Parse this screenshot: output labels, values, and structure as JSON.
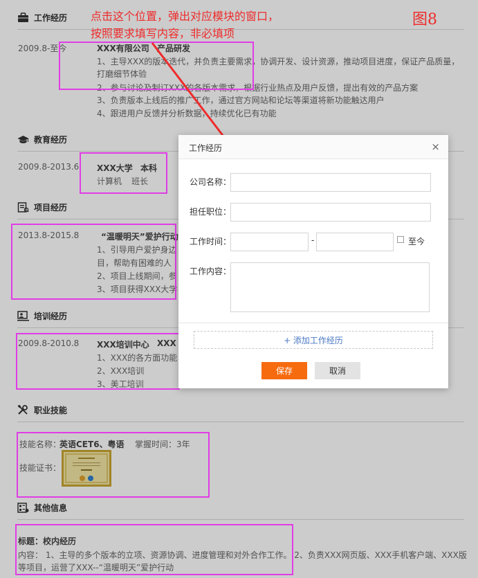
{
  "annotation": {
    "line1": "点击这个位置，弹出对应模块的窗口，",
    "line2": "按照要求填写内容，非必填项",
    "figure_label": "图8"
  },
  "work": {
    "title": "工作经历",
    "date": "2009.8-至今",
    "company": "XXX有限公司",
    "position": "产品研发",
    "items": [
      "1、主导XXX的版本迭代，并负责主要需求，协调开发、设计资源，推动项目进度，保证产品质量，",
      "打磨细节体验",
      "2、参与讨论及制订XXX的各版本需求，根据行业热点及用户反馈，提出有效的产品方案",
      "3、负责版本上线后的推广工作，通过官方网站和论坛等渠道将新功能触达用户",
      "4、跟进用户反馈并分析数据，持续优化已有功能"
    ]
  },
  "education": {
    "title": "教育经历",
    "date": "2009.8-2013.6",
    "school": "XXX大学",
    "degree": "本科",
    "major": "计算机",
    "role": "班长"
  },
  "project": {
    "title": "项目经历",
    "date": "2013.8-2015.8",
    "name": "“温暖明天”爱护行动",
    "items": [
      "1、引导用户爱护身边",
      "目，帮助有困难的人",
      "2、项目上线期间，参",
      "3、项目获得XXX大学"
    ]
  },
  "training": {
    "title": "培训经历",
    "date": "2009.8-2010.8",
    "org": "XXX培训中心",
    "course": "XXX",
    "items": [
      "1、XXX的各方面功能",
      "2、XXX培训",
      "3、美工培训"
    ]
  },
  "skills": {
    "title": "职业技能",
    "name_label": "技能名称：",
    "name_value": "英语CET6、粤语",
    "time_label": "掌握时间：",
    "time_value": "3年",
    "cert_label": "技能证书："
  },
  "other": {
    "title": "其他信息",
    "subject": "标题：校内经历",
    "content_line1": "内容： 1、主导的多个版本的立项、资源协调、进度管理和对外合作工作。 2、负责XXX网页版、XXX手机客户端、XXX版",
    "content_line2": "等项目，运营了XXX--“温暖明天”爱护行动"
  },
  "modal": {
    "title": "工作经历",
    "close": "×",
    "company_label": "公司名称：",
    "position_label": "担任职位：",
    "time_label": "工作时间：",
    "dash": "-",
    "until_now_label": "至今",
    "content_label": "工作内容：",
    "add_label": "+ 添加工作经历",
    "save_label": "保存",
    "cancel_label": "取消"
  },
  "colors": {
    "accent_orange": "#f76b0f",
    "annotation_red": "#ee2b2b",
    "highlight_magenta": "#e13ce6"
  }
}
